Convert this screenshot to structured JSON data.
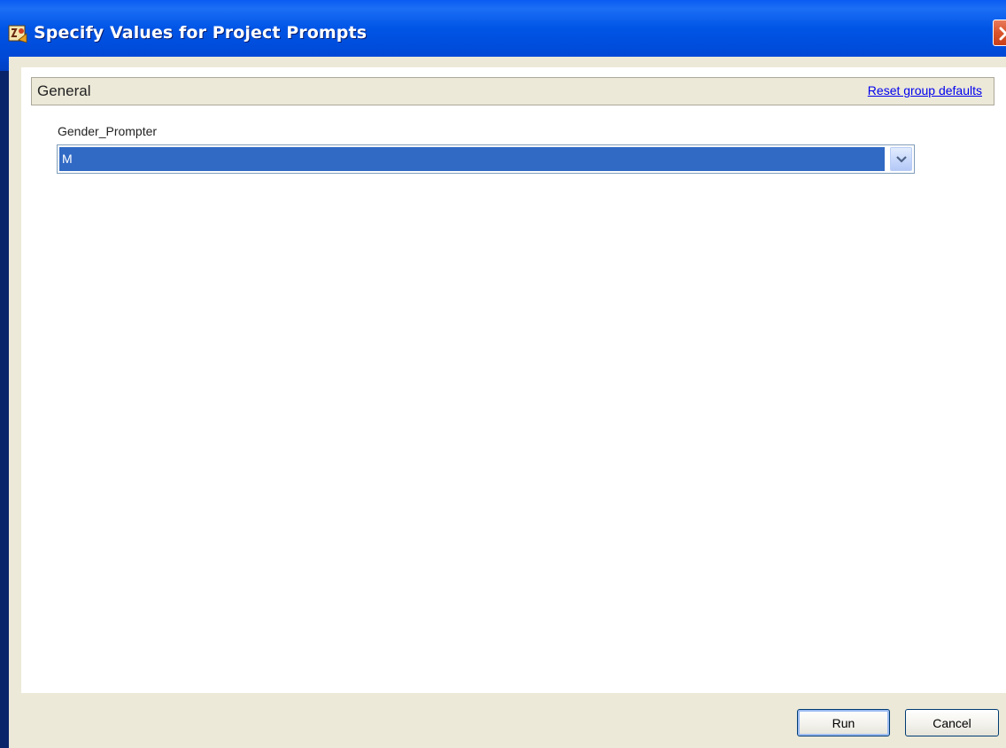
{
  "window": {
    "title": "Specify Values for Project Prompts",
    "accent_color": "#0055e6",
    "close_icon": "close-icon"
  },
  "group": {
    "title": "General",
    "reset_link": "Reset group defaults"
  },
  "prompt": {
    "label": "Gender_Prompter",
    "selected_value": "M",
    "selection_color": "#316ac5"
  },
  "buttons": {
    "run_label": "Run",
    "cancel_label": "Cancel"
  }
}
